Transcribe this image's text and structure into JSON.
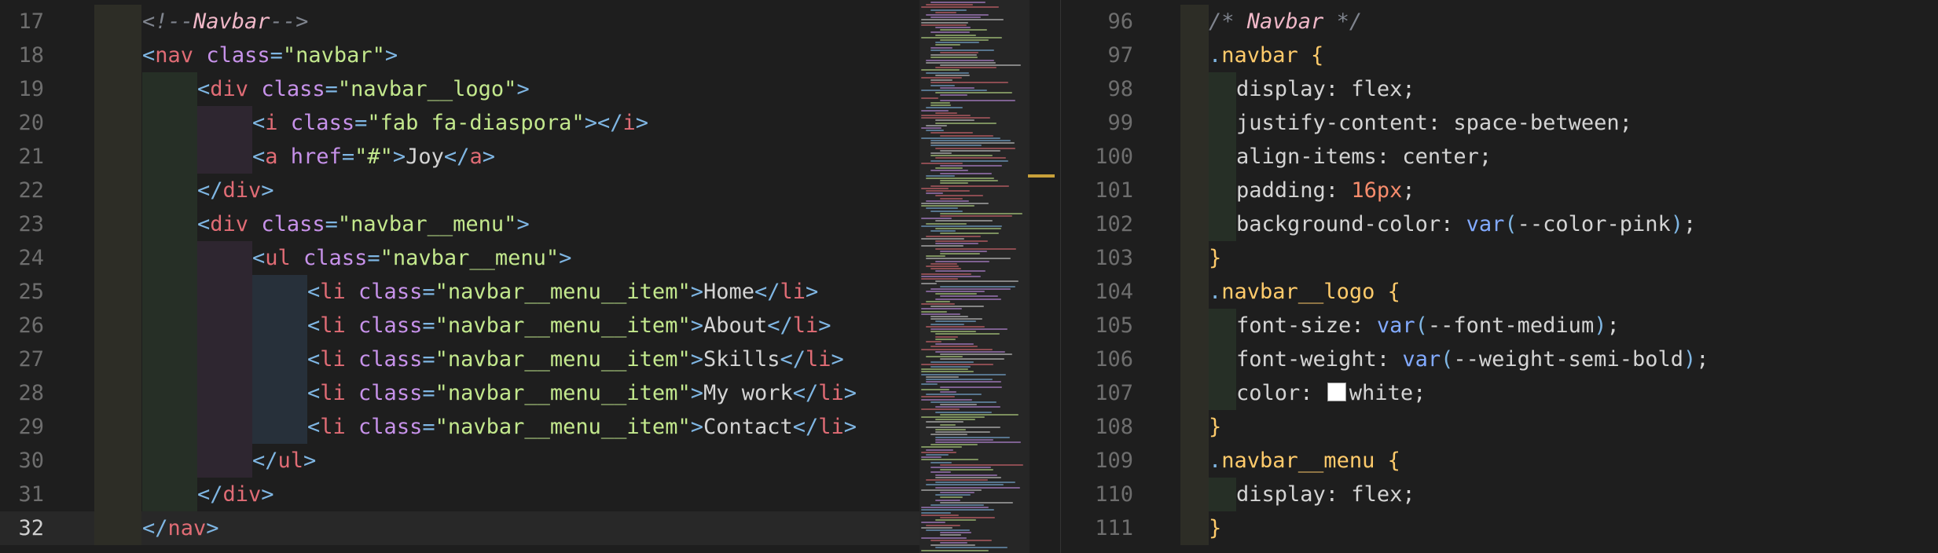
{
  "colors": {
    "background": "#1e1e1e",
    "line_number": "#6e6e6e",
    "tag": "#e06c75",
    "bracket": "#7fb6e3",
    "attribute": "#c792ea",
    "string": "#c3e88d",
    "comment": "#7f848e",
    "comment_text": "#f0b8c8",
    "selector": "#ffcb6b",
    "property": "#d4d4d4",
    "number": "#f78c6c",
    "function": "#82aaff",
    "text": "#d4d4d4"
  },
  "left_editor": {
    "lines": [
      {
        "num": "17",
        "indent": 0,
        "tokens": [
          [
            "comment",
            "<!--"
          ],
          [
            "comment_text",
            "Navbar"
          ],
          [
            "comment",
            "-->"
          ]
        ]
      },
      {
        "num": "18",
        "indent": 0,
        "tokens": [
          [
            "bracket",
            "<"
          ],
          [
            "tag",
            "nav"
          ],
          [
            "text",
            " "
          ],
          [
            "attribute",
            "class"
          ],
          [
            "bracket",
            "="
          ],
          [
            "string",
            "\"navbar\""
          ],
          [
            "bracket",
            ">"
          ]
        ]
      },
      {
        "num": "19",
        "indent": 1,
        "tokens": [
          [
            "bracket",
            "<"
          ],
          [
            "tag",
            "div"
          ],
          [
            "text",
            " "
          ],
          [
            "attribute",
            "class"
          ],
          [
            "bracket",
            "="
          ],
          [
            "string",
            "\"navbar__logo\""
          ],
          [
            "bracket",
            ">"
          ]
        ]
      },
      {
        "num": "20",
        "indent": 2,
        "tokens": [
          [
            "bracket",
            "<"
          ],
          [
            "tag",
            "i"
          ],
          [
            "text",
            " "
          ],
          [
            "attribute",
            "class"
          ],
          [
            "bracket",
            "="
          ],
          [
            "string",
            "\"fab fa-diaspora\""
          ],
          [
            "bracket",
            "></"
          ],
          [
            "tag",
            "i"
          ],
          [
            "bracket",
            ">"
          ]
        ]
      },
      {
        "num": "21",
        "indent": 2,
        "tokens": [
          [
            "bracket",
            "<"
          ],
          [
            "tag",
            "a"
          ],
          [
            "text",
            " "
          ],
          [
            "attribute",
            "href"
          ],
          [
            "bracket",
            "="
          ],
          [
            "string",
            "\"#\""
          ],
          [
            "bracket",
            ">"
          ],
          [
            "text",
            "Joy"
          ],
          [
            "bracket",
            "</"
          ],
          [
            "tag",
            "a"
          ],
          [
            "bracket",
            ">"
          ]
        ]
      },
      {
        "num": "22",
        "indent": 1,
        "tokens": [
          [
            "bracket",
            "</"
          ],
          [
            "tag",
            "div"
          ],
          [
            "bracket",
            ">"
          ]
        ]
      },
      {
        "num": "23",
        "indent": 1,
        "tokens": [
          [
            "bracket",
            "<"
          ],
          [
            "tag",
            "div"
          ],
          [
            "text",
            " "
          ],
          [
            "attribute",
            "class"
          ],
          [
            "bracket",
            "="
          ],
          [
            "string",
            "\"navbar__menu\""
          ],
          [
            "bracket",
            ">"
          ]
        ]
      },
      {
        "num": "24",
        "indent": 2,
        "tokens": [
          [
            "bracket",
            "<"
          ],
          [
            "tag",
            "ul"
          ],
          [
            "text",
            " "
          ],
          [
            "attribute",
            "class"
          ],
          [
            "bracket",
            "="
          ],
          [
            "string",
            "\"navbar__menu\""
          ],
          [
            "bracket",
            ">"
          ]
        ]
      },
      {
        "num": "25",
        "indent": 3,
        "tokens": [
          [
            "bracket",
            "<"
          ],
          [
            "tag",
            "li"
          ],
          [
            "text",
            " "
          ],
          [
            "attribute",
            "class"
          ],
          [
            "bracket",
            "="
          ],
          [
            "string",
            "\"navbar__menu__item\""
          ],
          [
            "bracket",
            ">"
          ],
          [
            "text",
            "Home"
          ],
          [
            "bracket",
            "</"
          ],
          [
            "tag",
            "li"
          ],
          [
            "bracket",
            ">"
          ]
        ]
      },
      {
        "num": "26",
        "indent": 3,
        "tokens": [
          [
            "bracket",
            "<"
          ],
          [
            "tag",
            "li"
          ],
          [
            "text",
            " "
          ],
          [
            "attribute",
            "class"
          ],
          [
            "bracket",
            "="
          ],
          [
            "string",
            "\"navbar__menu__item\""
          ],
          [
            "bracket",
            ">"
          ],
          [
            "text",
            "About"
          ],
          [
            "bracket",
            "</"
          ],
          [
            "tag",
            "li"
          ],
          [
            "bracket",
            ">"
          ]
        ]
      },
      {
        "num": "27",
        "indent": 3,
        "tokens": [
          [
            "bracket",
            "<"
          ],
          [
            "tag",
            "li"
          ],
          [
            "text",
            " "
          ],
          [
            "attribute",
            "class"
          ],
          [
            "bracket",
            "="
          ],
          [
            "string",
            "\"navbar__menu__item\""
          ],
          [
            "bracket",
            ">"
          ],
          [
            "text",
            "Skills"
          ],
          [
            "bracket",
            "</"
          ],
          [
            "tag",
            "li"
          ],
          [
            "bracket",
            ">"
          ]
        ]
      },
      {
        "num": "28",
        "indent": 3,
        "tokens": [
          [
            "bracket",
            "<"
          ],
          [
            "tag",
            "li"
          ],
          [
            "text",
            " "
          ],
          [
            "attribute",
            "class"
          ],
          [
            "bracket",
            "="
          ],
          [
            "string",
            "\"navbar__menu__item\""
          ],
          [
            "bracket",
            ">"
          ],
          [
            "text",
            "My work"
          ],
          [
            "bracket",
            "</"
          ],
          [
            "tag",
            "li"
          ],
          [
            "bracket",
            ">"
          ]
        ]
      },
      {
        "num": "29",
        "indent": 3,
        "tokens": [
          [
            "bracket",
            "<"
          ],
          [
            "tag",
            "li"
          ],
          [
            "text",
            " "
          ],
          [
            "attribute",
            "class"
          ],
          [
            "bracket",
            "="
          ],
          [
            "string",
            "\"navbar__menu__item\""
          ],
          [
            "bracket",
            ">"
          ],
          [
            "text",
            "Contact"
          ],
          [
            "bracket",
            "</"
          ],
          [
            "tag",
            "li"
          ],
          [
            "bracket",
            ">"
          ]
        ]
      },
      {
        "num": "30",
        "indent": 2,
        "tokens": [
          [
            "bracket",
            "</"
          ],
          [
            "tag",
            "ul"
          ],
          [
            "bracket",
            ">"
          ]
        ]
      },
      {
        "num": "31",
        "indent": 1,
        "tokens": [
          [
            "bracket",
            "</"
          ],
          [
            "tag",
            "div"
          ],
          [
            "bracket",
            ">"
          ]
        ]
      },
      {
        "num": "32",
        "indent": 0,
        "current": true,
        "tokens": [
          [
            "bracket",
            "</"
          ],
          [
            "tag",
            "nav"
          ],
          [
            "bracket",
            ">"
          ]
        ]
      }
    ]
  },
  "right_editor": {
    "lines": [
      {
        "num": "96",
        "indent": 0,
        "tokens": [
          [
            "comment",
            "/* "
          ],
          [
            "comment_text",
            "Navbar"
          ],
          [
            "comment",
            " */"
          ]
        ]
      },
      {
        "num": "97",
        "indent": 0,
        "tokens": [
          [
            "bracket",
            "."
          ],
          [
            "selector",
            "navbar {"
          ]
        ]
      },
      {
        "num": "98",
        "indent": 1,
        "tokens": [
          [
            "property",
            "display"
          ],
          [
            "text",
            ": flex;"
          ]
        ]
      },
      {
        "num": "99",
        "indent": 1,
        "tokens": [
          [
            "property",
            "justify-content"
          ],
          [
            "text",
            ": space-between;"
          ]
        ]
      },
      {
        "num": "100",
        "indent": 1,
        "tokens": [
          [
            "property",
            "align-items"
          ],
          [
            "text",
            ": center;"
          ]
        ]
      },
      {
        "num": "101",
        "indent": 1,
        "tokens": [
          [
            "property",
            "padding"
          ],
          [
            "text",
            ": "
          ],
          [
            "number",
            "16px"
          ],
          [
            "text",
            ";"
          ]
        ]
      },
      {
        "num": "102",
        "indent": 1,
        "tokens": [
          [
            "property",
            "background-color"
          ],
          [
            "text",
            ": "
          ],
          [
            "function",
            "var"
          ],
          [
            "bracket",
            "("
          ],
          [
            "text",
            "--color-pink"
          ],
          [
            "bracket",
            ")"
          ],
          [
            "text",
            ";"
          ]
        ]
      },
      {
        "num": "103",
        "indent": 0,
        "tokens": [
          [
            "selector",
            "}"
          ]
        ]
      },
      {
        "num": "104",
        "indent": 0,
        "tokens": [
          [
            "bracket",
            "."
          ],
          [
            "selector",
            "navbar__logo {"
          ]
        ]
      },
      {
        "num": "105",
        "indent": 1,
        "tokens": [
          [
            "property",
            "font-size"
          ],
          [
            "text",
            ": "
          ],
          [
            "function",
            "var"
          ],
          [
            "bracket",
            "("
          ],
          [
            "text",
            "--font-medium"
          ],
          [
            "bracket",
            ")"
          ],
          [
            "text",
            ";"
          ]
        ]
      },
      {
        "num": "106",
        "indent": 1,
        "tokens": [
          [
            "property",
            "font-weight"
          ],
          [
            "text",
            ": "
          ],
          [
            "function",
            "var"
          ],
          [
            "bracket",
            "("
          ],
          [
            "text",
            "--weight-semi-bold"
          ],
          [
            "bracket",
            ")"
          ],
          [
            "text",
            ";"
          ]
        ]
      },
      {
        "num": "107",
        "indent": 1,
        "tokens": [
          [
            "property",
            "color"
          ],
          [
            "text",
            ": "
          ],
          [
            "swatch",
            "#ffffff"
          ],
          [
            "text",
            "white;"
          ]
        ]
      },
      {
        "num": "108",
        "indent": 0,
        "tokens": [
          [
            "selector",
            "}"
          ]
        ]
      },
      {
        "num": "109",
        "indent": 0,
        "tokens": [
          [
            "bracket",
            "."
          ],
          [
            "selector",
            "navbar__menu {"
          ]
        ]
      },
      {
        "num": "110",
        "indent": 1,
        "tokens": [
          [
            "property",
            "display"
          ],
          [
            "text",
            ": flex;"
          ]
        ]
      },
      {
        "num": "111",
        "indent": 0,
        "tokens": [
          [
            "selector",
            "}"
          ]
        ]
      }
    ]
  }
}
